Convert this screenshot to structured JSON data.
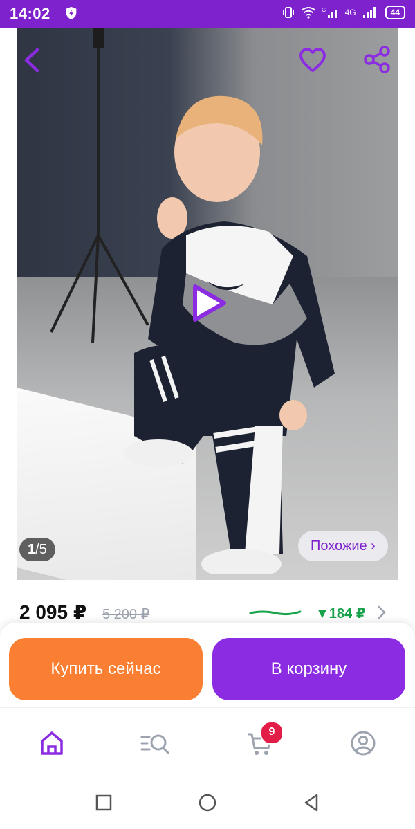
{
  "status_bar": {
    "time": "14:02",
    "network_label": "4G",
    "battery": "44",
    "icons": [
      "shield-icon",
      "vibrate-icon",
      "wifi-icon",
      "signal-icon",
      "battery-icon"
    ]
  },
  "product_gallery": {
    "counter_current": "1",
    "counter_total": "/5",
    "similar_label": "Похожие ›",
    "icons": [
      "back-arrow-icon",
      "heart-icon",
      "share-icon",
      "play-icon"
    ]
  },
  "price": {
    "current": "2 095 ₽",
    "old": "5 200 ₽",
    "drop": "▼184 ₽"
  },
  "actions": {
    "buy_now": "Купить сейчас",
    "add_to_cart": "В корзину"
  },
  "bottom_nav": {
    "cart_badge": "9",
    "items": [
      "home-icon",
      "catalog-search-icon",
      "cart-icon",
      "profile-icon"
    ]
  },
  "colors": {
    "brand_purple": "#7e22ce",
    "buy_orange": "#fb7f32",
    "cart_purple": "#8b2be2",
    "price_drop_green": "#16a34a",
    "badge_red": "#e11d48"
  }
}
